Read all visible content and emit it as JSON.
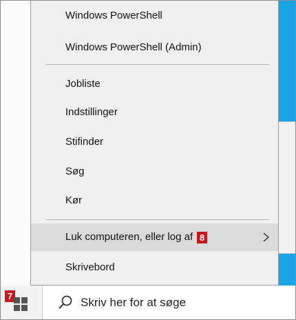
{
  "menu": {
    "items": [
      {
        "label": "Windows PowerShell"
      },
      {
        "label": "Windows PowerShell (Admin)"
      },
      {
        "label": "Jobliste"
      },
      {
        "label": "Indstillinger"
      },
      {
        "label": "Stifinder"
      },
      {
        "label": "Søg"
      },
      {
        "label": "Kør"
      },
      {
        "label": "Luk computeren, eller log af",
        "badge": "8",
        "submenu_icon": "chevron-right-icon"
      },
      {
        "label": "Skrivebord"
      }
    ]
  },
  "taskbar": {
    "start_badge": "7",
    "start_icon": "windows-logo-icon",
    "search": {
      "icon": "search-icon",
      "placeholder": "Skriv her for at søge"
    }
  },
  "colors": {
    "desktop": "#1aa4e4",
    "menu_bg": "#f0f0f0",
    "highlight": "#dadada",
    "badge": "#c8161d"
  }
}
